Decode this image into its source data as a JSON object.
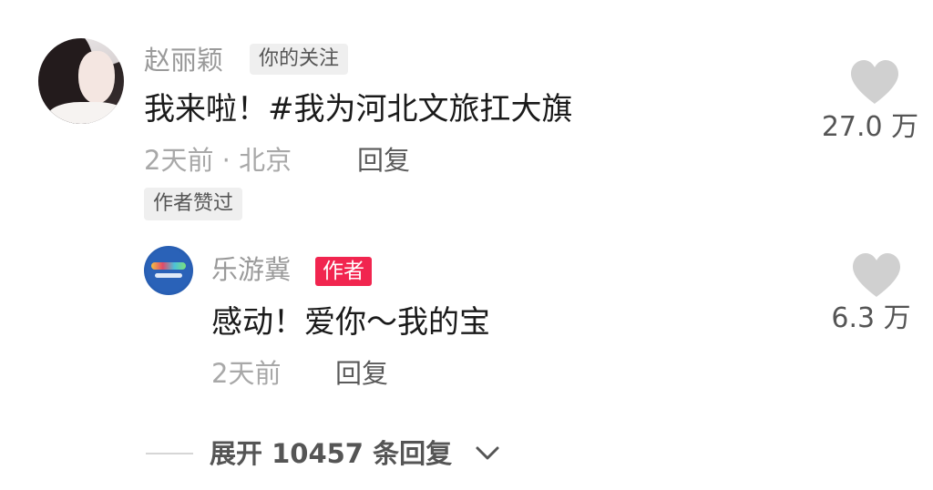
{
  "comment": {
    "author": "赵丽颖",
    "follow_badge": "你的关注",
    "text": "我来啦！#我为河北文旅扛大旗",
    "meta": "2天前 · 北京",
    "reply_label": "回复",
    "liked_badge": "作者赞过",
    "like_count": "27.0 万",
    "avatar_icon": "user-avatar-photo"
  },
  "reply": {
    "author": "乐游冀",
    "author_badge": "作者",
    "text": "感动！爱你～我的宝",
    "meta": "2天前",
    "reply_label": "回复",
    "like_count": "6.3 万",
    "avatar_icon": "brand-logo-avatar"
  },
  "expand": {
    "label": "展开 10457 条回复",
    "icon": "chevron-down-icon"
  },
  "colors": {
    "badge_red": "#f1254f",
    "heart_gray": "#d0d0d0"
  }
}
